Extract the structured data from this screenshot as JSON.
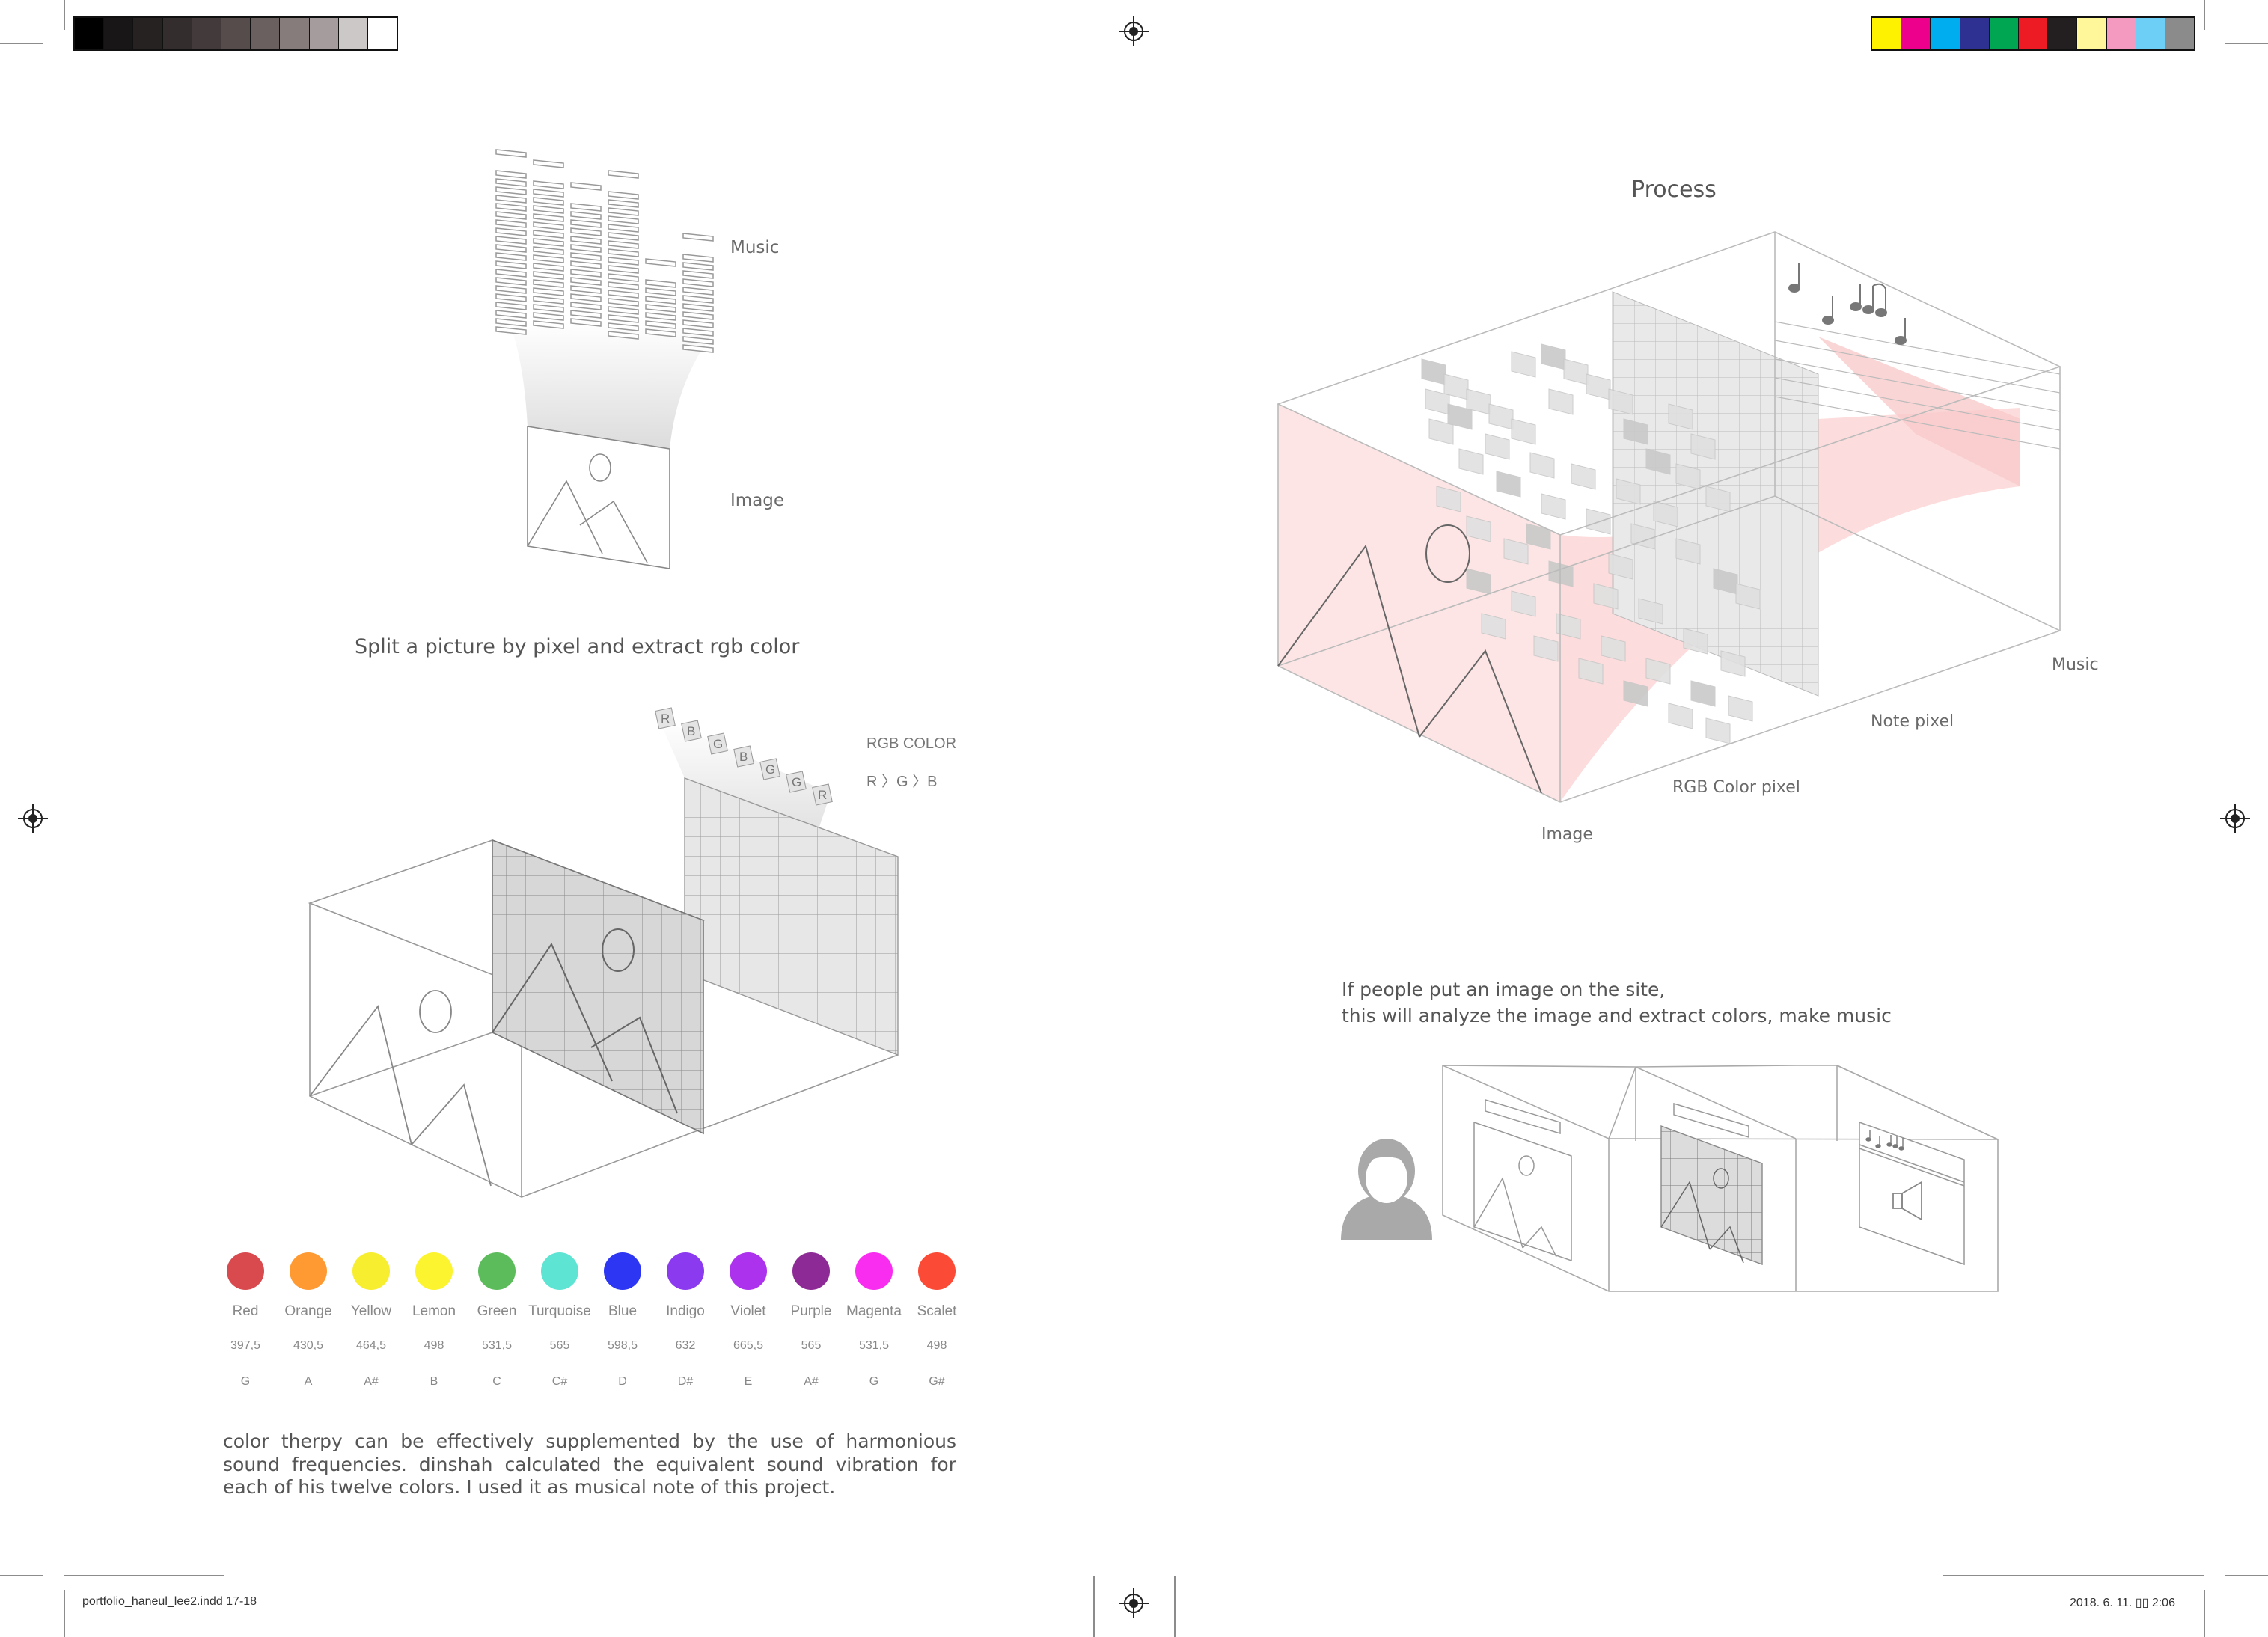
{
  "left_page": {
    "diagram1": {
      "music_label": "Music",
      "image_label": "Image"
    },
    "split_caption": "Split a picture by pixel and extract rgb color",
    "diagram2": {
      "rgb_title": "RGB COLOR",
      "rgb_order": "R 〉G 〉B",
      "tiles": [
        "R",
        "B",
        "G",
        "B",
        "G",
        "G",
        "R"
      ]
    },
    "colors": [
      {
        "name": "Red",
        "freq": "397,5",
        "note": "G",
        "color": "#d94a4f"
      },
      {
        "name": "Orange",
        "freq": "430,5",
        "note": "A",
        "color": "#ff9a33"
      },
      {
        "name": "Yellow",
        "freq": "464,5",
        "note": "A#",
        "color": "#f7ee2f"
      },
      {
        "name": "Lemon",
        "freq": "498",
        "note": "B",
        "color": "#fbf42e"
      },
      {
        "name": "Green",
        "freq": "531,5",
        "note": "C",
        "color": "#5cbc5c"
      },
      {
        "name": "Turquoise",
        "freq": "565",
        "note": "C#",
        "color": "#5ee4d3"
      },
      {
        "name": "Blue",
        "freq": "598,5",
        "note": "D",
        "color": "#2d36f2"
      },
      {
        "name": "Indigo",
        "freq": "632",
        "note": "D#",
        "color": "#8c3af0"
      },
      {
        "name": "Violet",
        "freq": "665,5",
        "note": "E",
        "color": "#ad32ee"
      },
      {
        "name": "Purple",
        "freq": "565",
        "note": "A#",
        "color": "#8e2a96"
      },
      {
        "name": "Magenta",
        "freq": "531,5",
        "note": "G",
        "color": "#f92df0"
      },
      {
        "name": "Scalet",
        "freq": "498",
        "note": "G#",
        "color": "#fb4a35"
      }
    ],
    "paragraph": "color therpy can be effectively supplemented by the use of harmonious sound frequencies. dinshah calculated the equivalent sound vibration for each of his twelve colors. I used it as musical note of this project."
  },
  "right_page": {
    "process_title": "Process",
    "labels": {
      "music": "Music",
      "note_pixel": "Note pixel",
      "rgb_pixel": "RGB Color pixel",
      "image": "Image"
    },
    "description_line1": "If people put an image on the site,",
    "description_line2": "this will analyze the image and extract colors, make music"
  },
  "print_marks": {
    "footer_file": "portfolio_haneul_lee2.indd   17-18",
    "footer_date": "2018. 6. 11.   ▯▯ 2:06",
    "gray_swatches": [
      "#000000",
      "#181616",
      "#262222",
      "#332d2d",
      "#433b3b",
      "#564c4c",
      "#6b6060",
      "#867c7c",
      "#a59d9d",
      "#cdc8c8",
      "#ffffff"
    ],
    "color_swatches": [
      "#fff200",
      "#ec008c",
      "#00aeef",
      "#2e3192",
      "#00a651",
      "#ed1c24",
      "#231f20",
      "#fff799",
      "#f49ac1",
      "#6dcff6",
      "#8b8b8b"
    ]
  }
}
